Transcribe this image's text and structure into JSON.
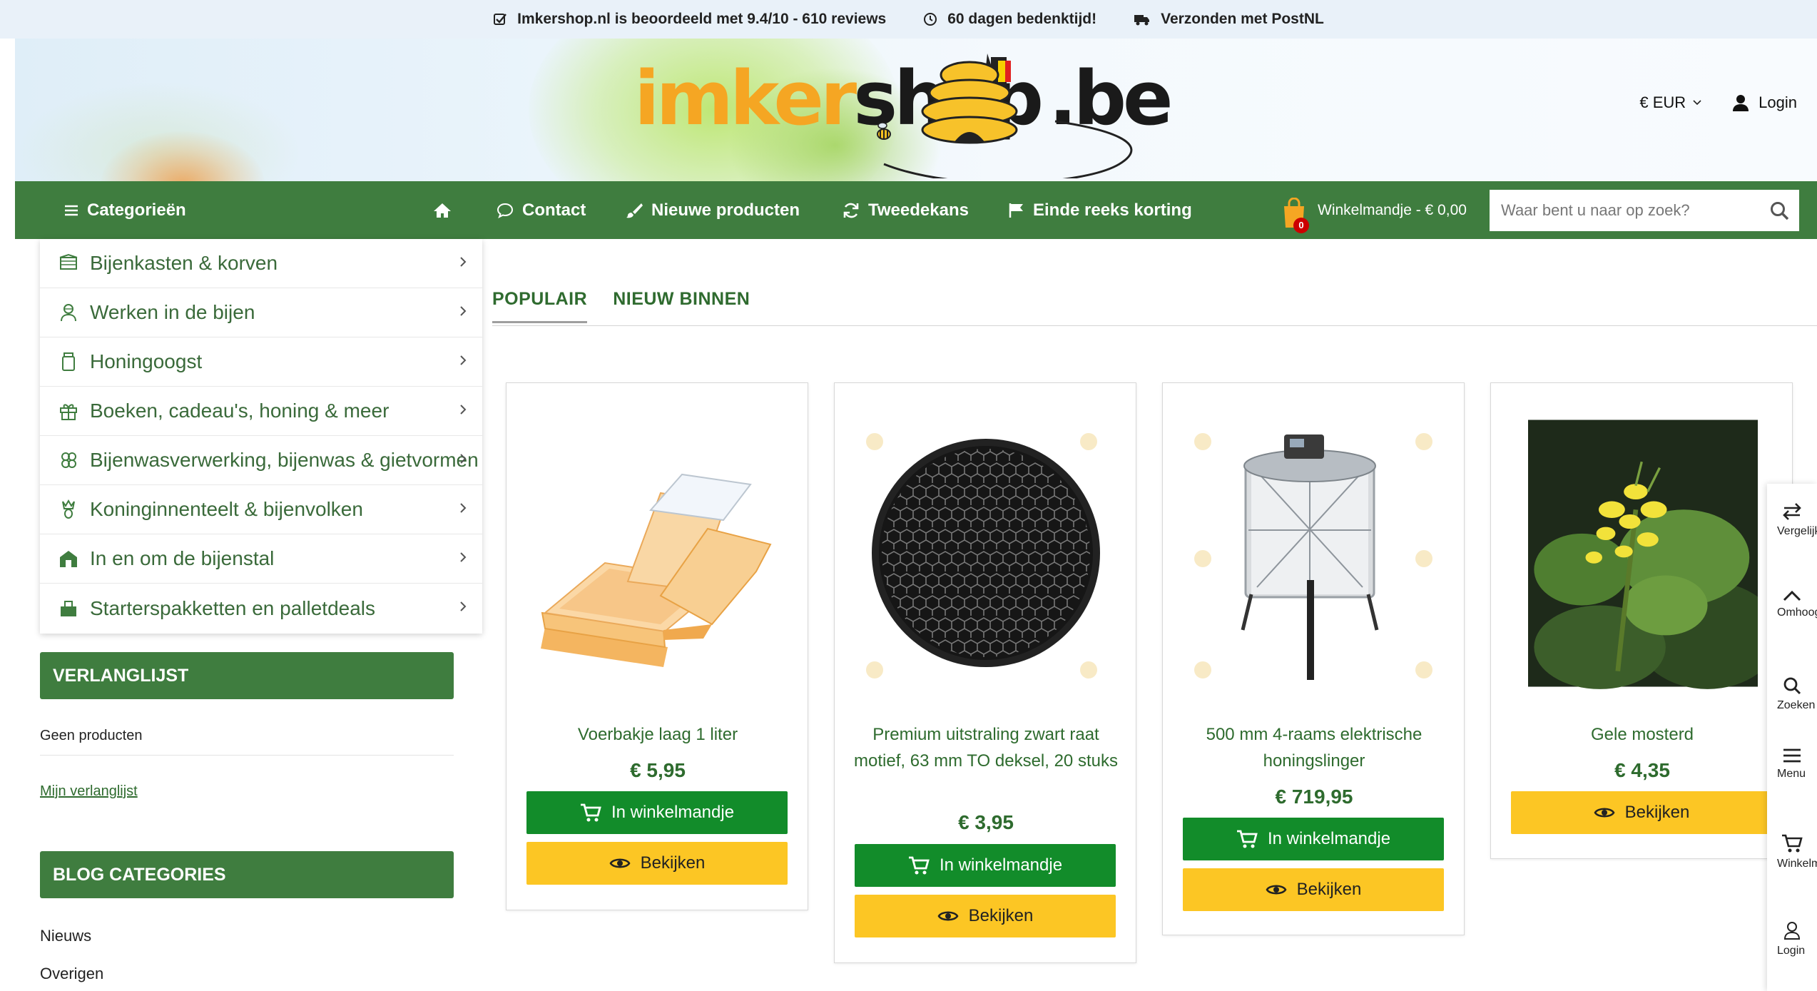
{
  "topbar": {
    "rating": "Imkershop.nl is beoordeeld met 9.4/10 - 610 reviews",
    "return": "60 dagen bedenktijd!",
    "shipping": "Verzonden met PostNL"
  },
  "header": {
    "logo_part1": "imker",
    "logo_part2": "shop",
    "logo_part3": ".be",
    "currency": "€ EUR",
    "login": "Login"
  },
  "nav": {
    "categories": "Categorieën",
    "contact": "Contact",
    "new_products": "Nieuwe producten",
    "second_chance": "Tweedekans",
    "end_of_range": "Einde reeks korting",
    "cart_label": "Winkelmandje - € 0,00",
    "cart_count": "0",
    "search_placeholder": "Waar bent u naar op zoek?"
  },
  "categories": [
    {
      "label": "Bijenkasten & korven",
      "icon": "beehive-icon"
    },
    {
      "label": "Werken in de bijen",
      "icon": "beekeeper-icon"
    },
    {
      "label": "Honingoogst",
      "icon": "honey-jar-icon"
    },
    {
      "label": "Boeken, cadeau's, honing & meer",
      "icon": "gift-icon"
    },
    {
      "label": "Bijenwasverwerking, bijenwas & gietvormen",
      "icon": "wax-icon"
    },
    {
      "label": "Koninginnenteelt & bijenvolken",
      "icon": "queen-bee-icon"
    },
    {
      "label": "In en om de bijenstal",
      "icon": "bee-shed-icon"
    },
    {
      "label": "Starterspakketten en palletdeals",
      "icon": "starter-kit-icon"
    }
  ],
  "wishlist": {
    "title": "VERLANGLIJST",
    "empty": "Geen producten",
    "link": "Mijn verlanglijst"
  },
  "blog": {
    "title": "BLOG CATEGORIES",
    "items": [
      "Nieuws",
      "Overigen"
    ]
  },
  "tabs": {
    "popular": "POPULAIR",
    "new_in": "NIEUW BINNEN"
  },
  "products": [
    {
      "name": "Voerbakje laag 1 liter",
      "price": "€ 5,95",
      "cart": "In winkelmandje",
      "view": "Bekijken"
    },
    {
      "name": "Premium uitstraling zwart raat motief, 63 mm TO deksel, 20 stuks",
      "price": "€ 3,95",
      "cart": "In winkelmandje",
      "view": "Bekijken"
    },
    {
      "name": "500 mm 4-raams elektrische honingslinger",
      "price": "€ 719,95",
      "cart": "In winkelmandje",
      "view": "Bekijken"
    },
    {
      "name": "Gele mosterd",
      "price": "€ 4,35",
      "view": "Bekijken"
    }
  ],
  "right_panel": {
    "compare": "Vergelijk",
    "top": "Omhoog",
    "search": "Zoeken",
    "menu": "Menu",
    "cart": "Winkelmandje",
    "login": "Login"
  },
  "colors": {
    "brand_green": "#3f7d3f",
    "cart_button": "#128c2a",
    "view_button": "#fcc624",
    "logo_orange": "#f5a623"
  }
}
